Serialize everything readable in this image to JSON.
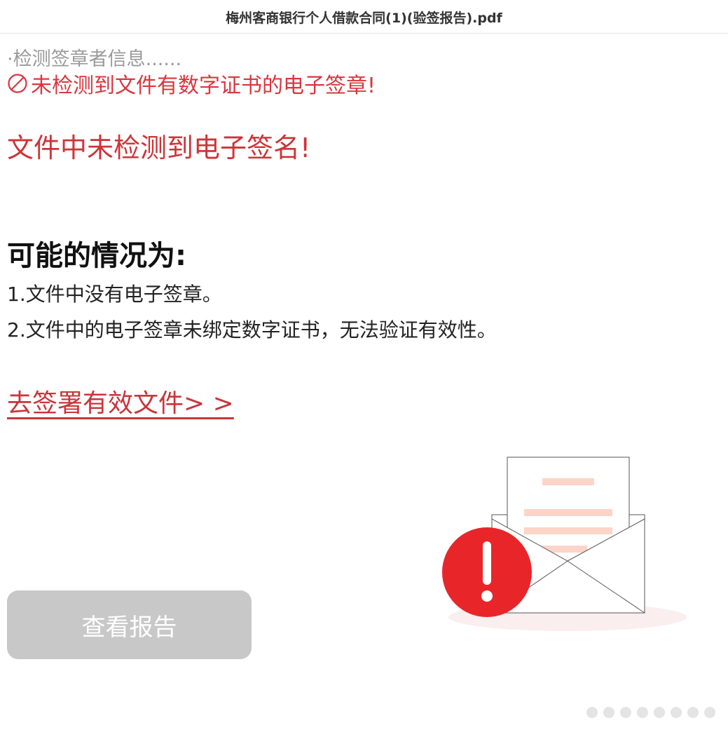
{
  "window": {
    "title": "梅州客商银行个人借款合同(1)(验签报告).pdf"
  },
  "verification": {
    "status_text": "·检测签章者信息......",
    "warning_icon": "ban-icon",
    "warning_text": "未检测到文件有数字证书的电子签章!",
    "headline": "文件中未检测到电子签名!"
  },
  "reasons": {
    "heading": "可能的情况为:",
    "items": [
      "1.文件中没有电子签章。",
      "2.文件中的电子签章未绑定数字证书，无法验证有效性。"
    ]
  },
  "actions": {
    "sign_link": "去签署有效文件> >",
    "view_report": "查看报告"
  },
  "colors": {
    "accent_red": "#d9363e",
    "alert_red": "#e8262a",
    "button_gray": "#c8c8c8"
  }
}
